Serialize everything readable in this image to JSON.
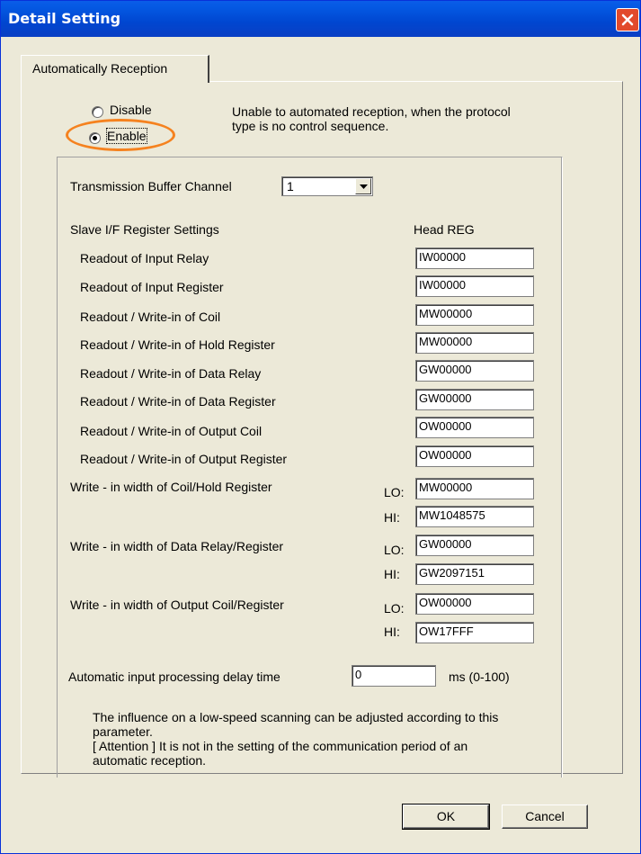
{
  "window": {
    "title": "Detail Setting"
  },
  "tab": {
    "label": "Automatically Reception"
  },
  "reception": {
    "options": [
      {
        "label": "Disable",
        "selected": false
      },
      {
        "label": "Enable",
        "selected": true
      }
    ],
    "note": "Unable to automated reception, when the protocol type is no control sequence."
  },
  "transmission": {
    "label": "Transmission Buffer Channel",
    "value": "1"
  },
  "slave": {
    "title": "Slave I/F Register Settings",
    "head_label": "Head REG",
    "rows": [
      {
        "label": "Readout of Input Relay",
        "value": "IW00000"
      },
      {
        "label": "Readout of Input Register",
        "value": "IW00000"
      },
      {
        "label": "Readout / Write-in of Coil",
        "value": "MW00000"
      },
      {
        "label": "Readout / Write-in of Hold Register",
        "value": "MW00000"
      },
      {
        "label": "Readout / Write-in of Data Relay",
        "value": "GW00000"
      },
      {
        "label": "Readout / Write-in of Data Register",
        "value": "GW00000"
      },
      {
        "label": "Readout / Write-in of Output Coil",
        "value": "OW00000"
      },
      {
        "label": "Readout / Write-in of Output Register",
        "value": "OW00000"
      }
    ],
    "widths": [
      {
        "label": "Write - in width of Coil/Hold Register",
        "lo_label": "LO:",
        "lo": "MW00000",
        "hi_label": "HI:",
        "hi": "MW1048575"
      },
      {
        "label": "Write - in width of Data Relay/Register",
        "lo_label": "LO:",
        "lo": "GW00000",
        "hi_label": "HI:",
        "hi": "GW2097151"
      },
      {
        "label": "Write - in width of Output Coil/Register",
        "lo_label": "LO:",
        "lo": "OW00000",
        "hi_label": "HI:",
        "hi": "OW17FFF"
      }
    ]
  },
  "delay": {
    "label": "Automatic input processing delay time",
    "value": "0",
    "unit": "ms (0-100)"
  },
  "help": "The influence on a low-speed scanning can be adjusted according to this parameter.\n[ Attention ] It is not in the setting of the communication period of an automatic reception.",
  "buttons": {
    "ok": "OK",
    "cancel": "Cancel"
  },
  "colors": {
    "titlebar": "#0055e5",
    "highlight": "#f5821f",
    "close": "#e24a2b"
  },
  "icons": {
    "close": "close-icon",
    "dropdown": "chevron-down-icon"
  }
}
